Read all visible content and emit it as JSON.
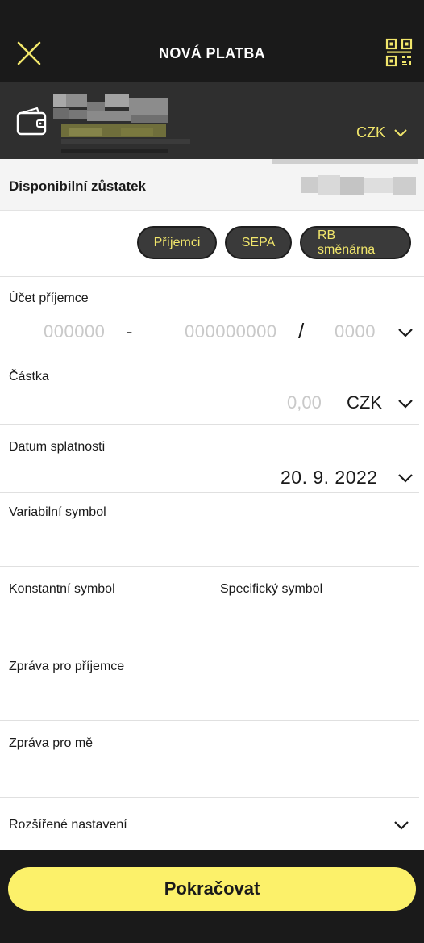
{
  "header": {
    "title": "NOVÁ PLATBA",
    "close_icon": "close-icon",
    "qr_icon": "qr-code-icon"
  },
  "account": {
    "wallet_icon": "wallet-icon",
    "currency": "CZK"
  },
  "balance": {
    "label": "Disponibilní zůstatek"
  },
  "chips": [
    {
      "label": "Příjemci"
    },
    {
      "label": "SEPA"
    },
    {
      "label": "RB směnárna"
    }
  ],
  "form": {
    "recipient_account": {
      "label": "Účet příjemce",
      "prefix_placeholder": "000000",
      "separator_dash": "-",
      "number_placeholder": "000000000",
      "separator_slash": "/",
      "bank_code_placeholder": "0000"
    },
    "amount": {
      "label": "Částka",
      "placeholder": "0,00",
      "currency": "CZK"
    },
    "due_date": {
      "label": "Datum splatnosti",
      "value": "20. 9. 2022"
    },
    "variable_symbol": {
      "label": "Variabilní symbol"
    },
    "constant_symbol": {
      "label": "Konstantní symbol"
    },
    "specific_symbol": {
      "label": "Specifický symbol"
    },
    "message_recipient": {
      "label": "Zpráva pro příjemce"
    },
    "message_me": {
      "label": "Zpráva pro mě"
    },
    "advanced": {
      "label": "Rozšířené nastavení"
    }
  },
  "footer": {
    "continue_label": "Pokračovat"
  },
  "colors": {
    "header_bg": "#1a1a1a",
    "accent_yellow": "#fcf16a",
    "chip_text": "#f1e66b"
  }
}
